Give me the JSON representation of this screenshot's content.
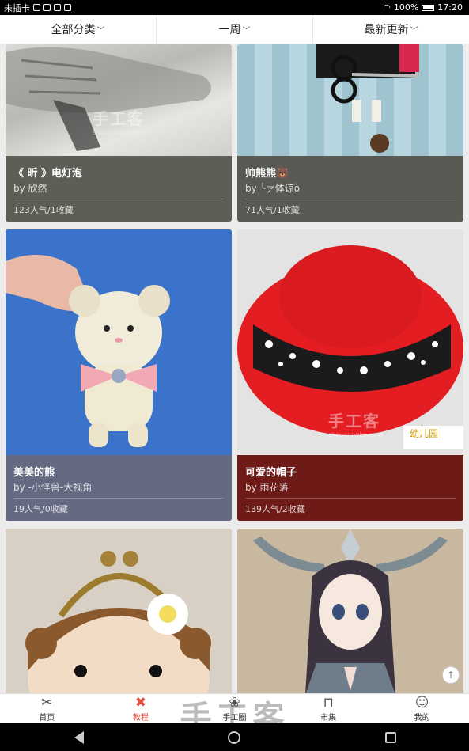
{
  "status": {
    "carrier": "未插卡",
    "battery": "100%",
    "time": "17:20"
  },
  "filters": [
    {
      "label": "全部分类"
    },
    {
      "label": "一周"
    },
    {
      "label": "最新更新"
    }
  ],
  "cards": [
    {
      "title": "《 昕 》电灯泡",
      "author": "by 欣然",
      "stats": "123人气/1收藏",
      "color": "#5e5e56"
    },
    {
      "title": "帅熊熊🐻",
      "author": "by ╰ァ体谅ò",
      "stats": "71人气/1收藏",
      "color": "#595a53"
    },
    {
      "title": "美美的熊",
      "author": "by -小怪兽-大视角",
      "stats": "19人气/0收藏",
      "color": "#656a82"
    },
    {
      "title": "可爱的帽子",
      "author": "by 雨花落",
      "stats": "139人气/2收藏",
      "color": "#6e1b17"
    }
  ],
  "watermark": {
    "text": "手工客",
    "sub": "shougongke.com"
  },
  "tabs": [
    {
      "label": "首页",
      "icon": "scissors-icon"
    },
    {
      "label": "教程",
      "icon": "cross-icon"
    },
    {
      "label": "手工圈",
      "icon": "flower-icon"
    },
    {
      "label": "市集",
      "icon": "bag-icon"
    },
    {
      "label": "我的",
      "icon": "user-icon"
    }
  ],
  "colors": {
    "accent": "#e84a3b"
  }
}
